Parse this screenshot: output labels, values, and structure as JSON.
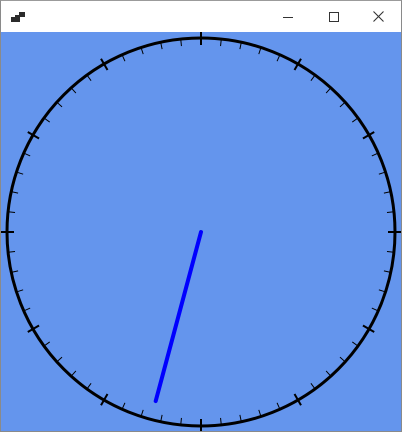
{
  "window": {
    "icon": "app-icon",
    "controls": [
      "minimize-icon",
      "maximize-icon",
      "close-icon"
    ]
  },
  "clock": {
    "face_color": "#6495ed",
    "rim_color": "#000000",
    "hand_color": "#0000ff",
    "tick_count": 60,
    "major_every": 5,
    "hand_minutes": 32.5
  }
}
